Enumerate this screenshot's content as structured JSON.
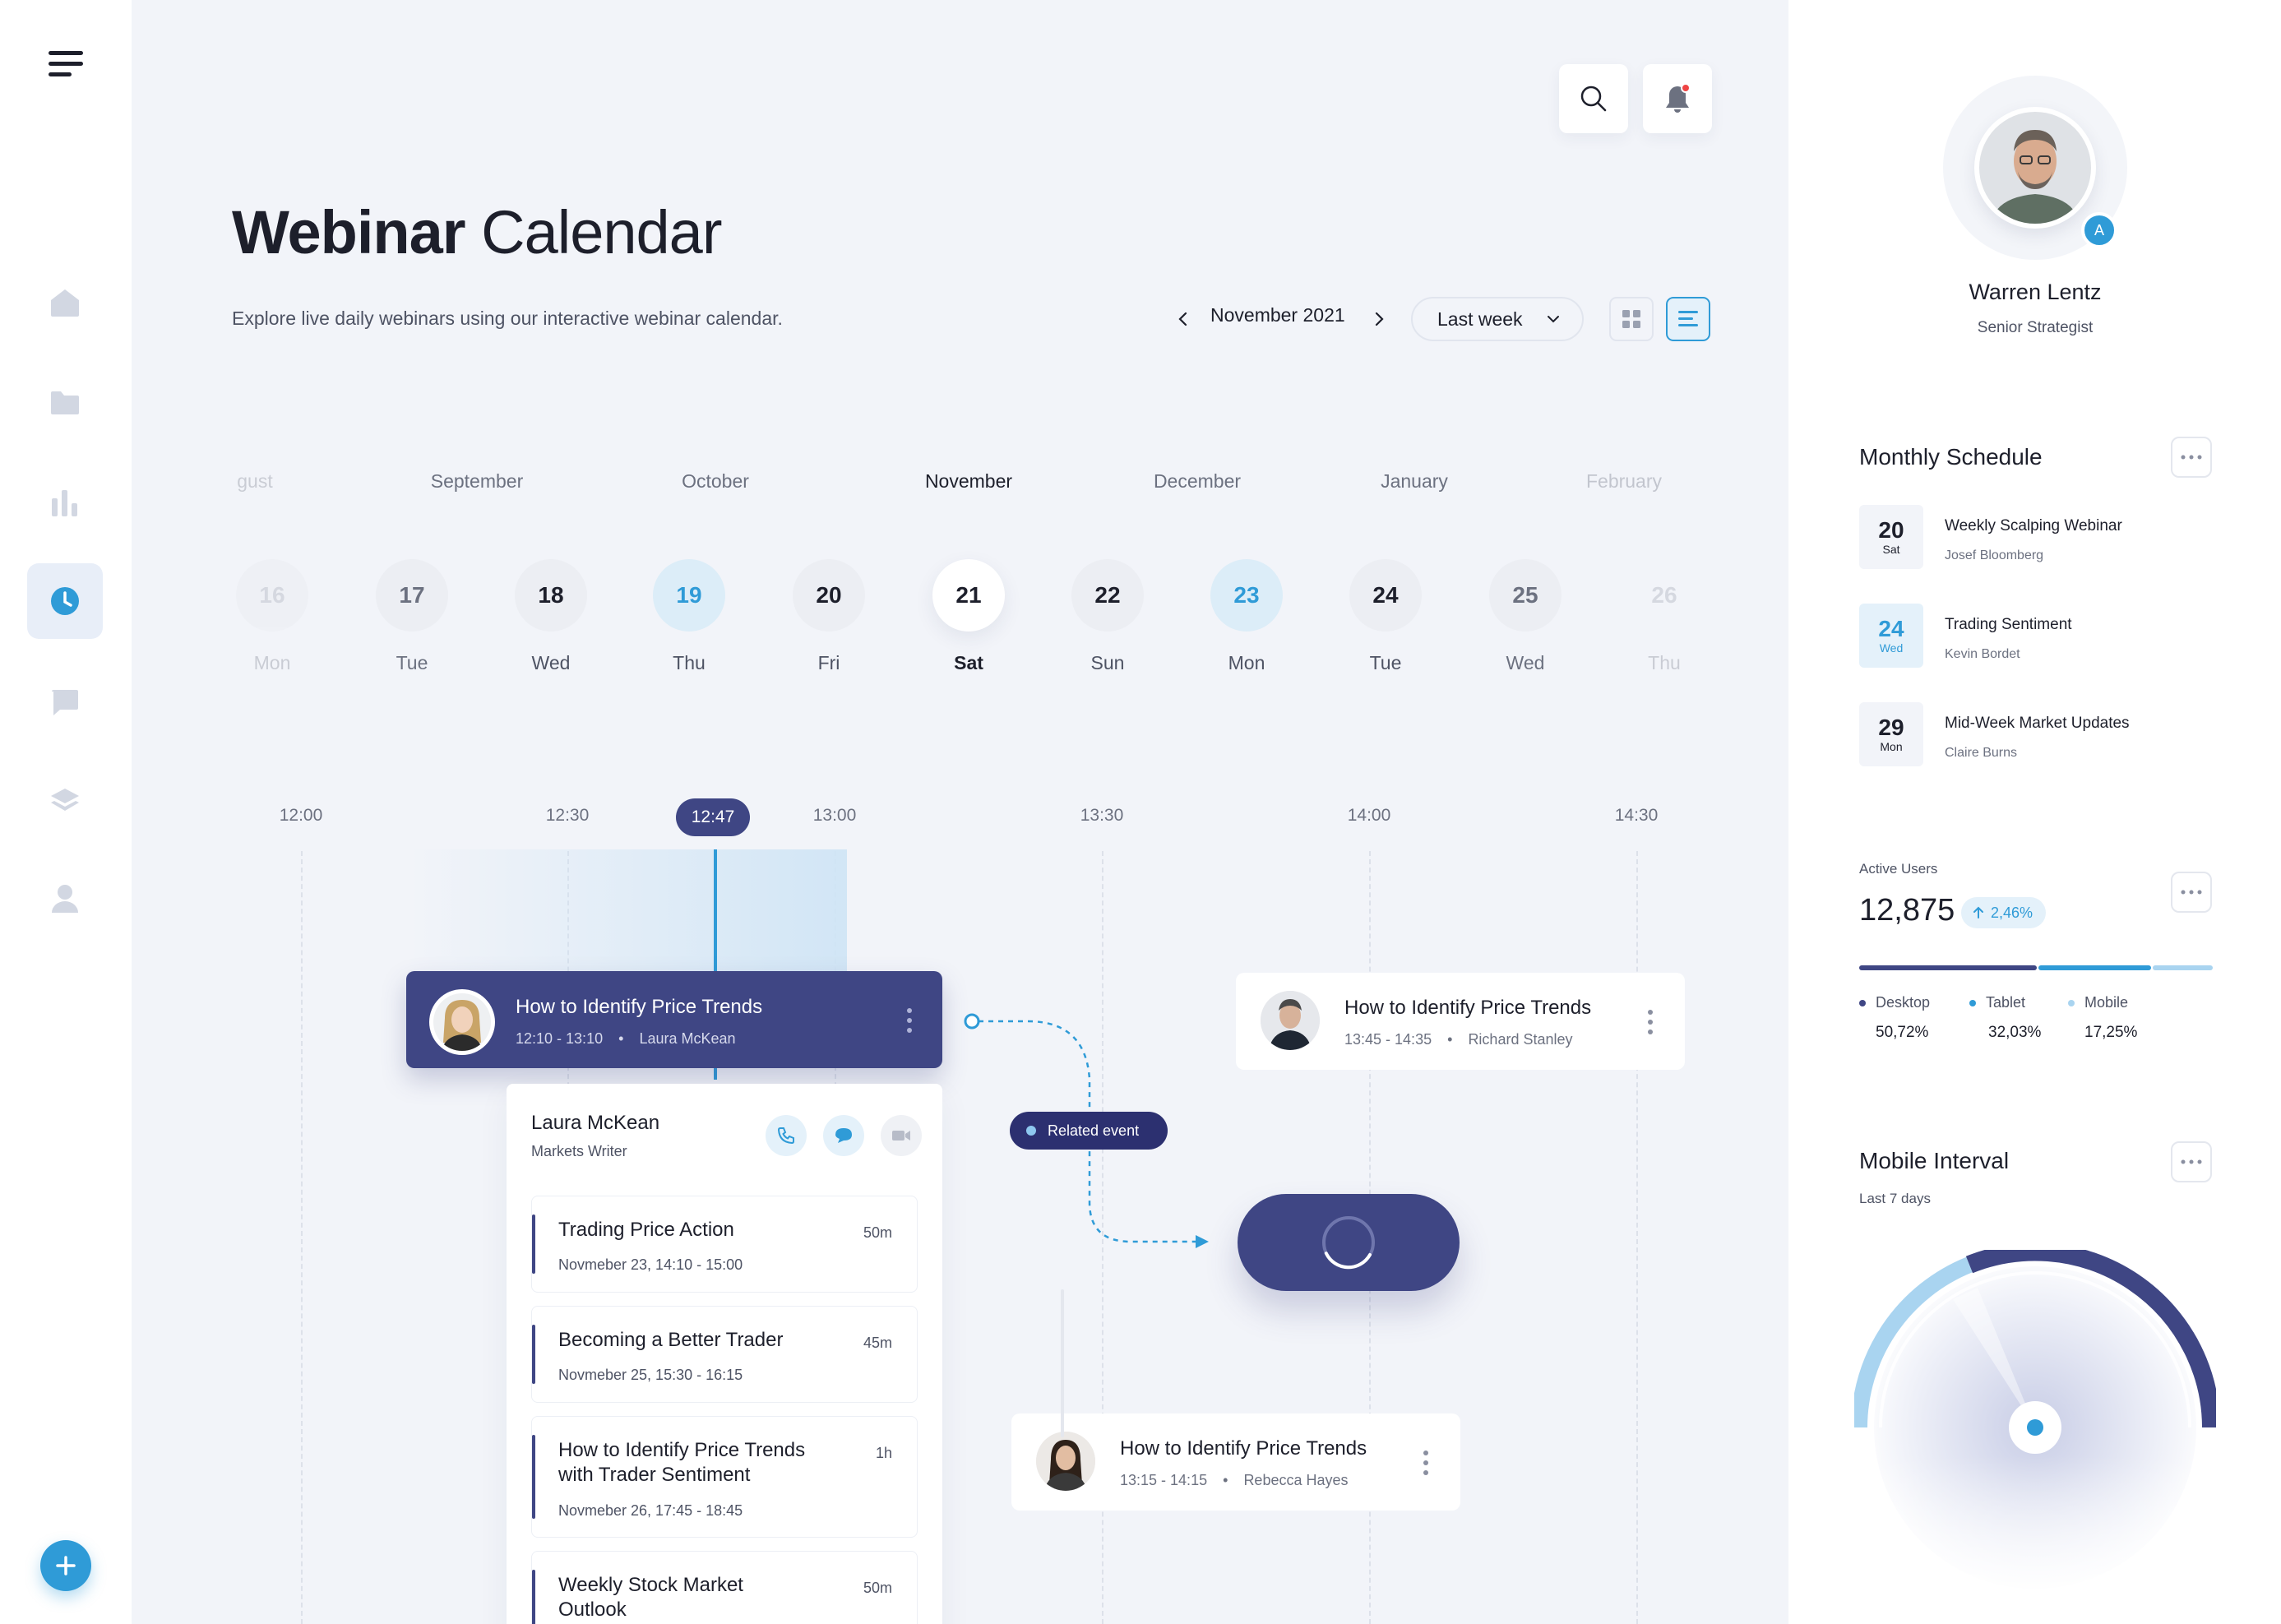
{
  "page": {
    "title_bold": "Webinar",
    "title_light": "Calendar",
    "subtitle": "Explore live daily webinars using our interactive webinar calendar."
  },
  "sidebar": {
    "items": [
      {
        "icon": "menu-icon"
      },
      {
        "icon": "home-icon"
      },
      {
        "icon": "folder-icon"
      },
      {
        "icon": "bar-chart-icon"
      },
      {
        "icon": "clock-icon",
        "active": true
      },
      {
        "icon": "chat-icon"
      },
      {
        "icon": "layers-icon"
      },
      {
        "icon": "user-icon"
      },
      {
        "icon": "plus-icon"
      }
    ]
  },
  "header": {
    "month_label": "November 2021",
    "range_select": "Last week",
    "notification_dot_color": "#ef4444"
  },
  "months": [
    "gust",
    "September",
    "October",
    "November",
    "December",
    "January",
    "February"
  ],
  "days": [
    {
      "num": "16",
      "dow": "Mon"
    },
    {
      "num": "17",
      "dow": "Tue"
    },
    {
      "num": "18",
      "dow": "Wed"
    },
    {
      "num": "19",
      "dow": "Thu"
    },
    {
      "num": "20",
      "dow": "Fri"
    },
    {
      "num": "21",
      "dow": "Sat"
    },
    {
      "num": "22",
      "dow": "Sun"
    },
    {
      "num": "23",
      "dow": "Mon"
    },
    {
      "num": "24",
      "dow": "Tue"
    },
    {
      "num": "25",
      "dow": "Wed"
    },
    {
      "num": "26",
      "dow": "Thu"
    }
  ],
  "timeline": {
    "labels": [
      "12:00",
      "12:30",
      "13:00",
      "13:30",
      "14:00",
      "14:30"
    ],
    "current_time": "12:47"
  },
  "events": {
    "main": {
      "title": "How to Identify Price Trends",
      "time": "12:10 - 13:10",
      "host": "Laura McKean"
    },
    "right": {
      "title": "How to Identify Price Trends",
      "time": "13:45 - 14:35",
      "host": "Richard Stanley"
    },
    "bottom": {
      "title": "How to Identify Price Trends",
      "time": "13:15 - 14:15",
      "host": "Rebecca Hayes"
    },
    "related_label": "Related event",
    "dot": "•"
  },
  "host_panel": {
    "name": "Laura McKean",
    "role": "Markets Writer",
    "items": [
      {
        "title": "Trading Price Action",
        "date": "Novmeber 23, 14:10 - 15:00",
        "duration": "50m"
      },
      {
        "title": "Becoming a Better Trader",
        "date": "Novmeber 25, 15:30 - 16:15",
        "duration": "45m"
      },
      {
        "title": "How to Identify Price Trends with Trader Sentiment",
        "date": "Novmeber 26, 17:45 - 18:45",
        "duration": "1h"
      },
      {
        "title": "Weekly Stock Market Outlook",
        "date": "",
        "duration": "50m"
      }
    ]
  },
  "profile": {
    "name": "Warren Lentz",
    "role": "Senior Strategist",
    "badge": "A"
  },
  "monthly_schedule": {
    "title": "Monthly Schedule",
    "items": [
      {
        "day": "20",
        "dow": "Sat",
        "title": "Weekly Scalping Webinar",
        "host": "Josef Bloomberg"
      },
      {
        "day": "24",
        "dow": "Wed",
        "title": "Trading Sentiment",
        "host": "Kevin Bordet"
      },
      {
        "day": "29",
        "dow": "Mon",
        "title": "Mid-Week Market Updates",
        "host": "Claire Burns"
      }
    ]
  },
  "active_users": {
    "label": "Active Users",
    "value": "12,875",
    "change": "2,46%",
    "breakdown": [
      {
        "name": "Desktop",
        "value": "50,72%",
        "share": 0.5072,
        "color": "#3f4684"
      },
      {
        "name": "Tablet",
        "value": "32,03%",
        "share": 0.3203,
        "color": "#2f9bd7"
      },
      {
        "name": "Mobile",
        "value": "17,25%",
        "share": 0.1725,
        "color": "#a9d4f0"
      }
    ]
  },
  "mobile_interval": {
    "title": "Mobile Interval",
    "subtitle": "Last 7 days"
  },
  "colors": {
    "accent_dark": "#3f4684",
    "accent_blue": "#2f9bd7",
    "light_blue": "#dcedf8"
  }
}
